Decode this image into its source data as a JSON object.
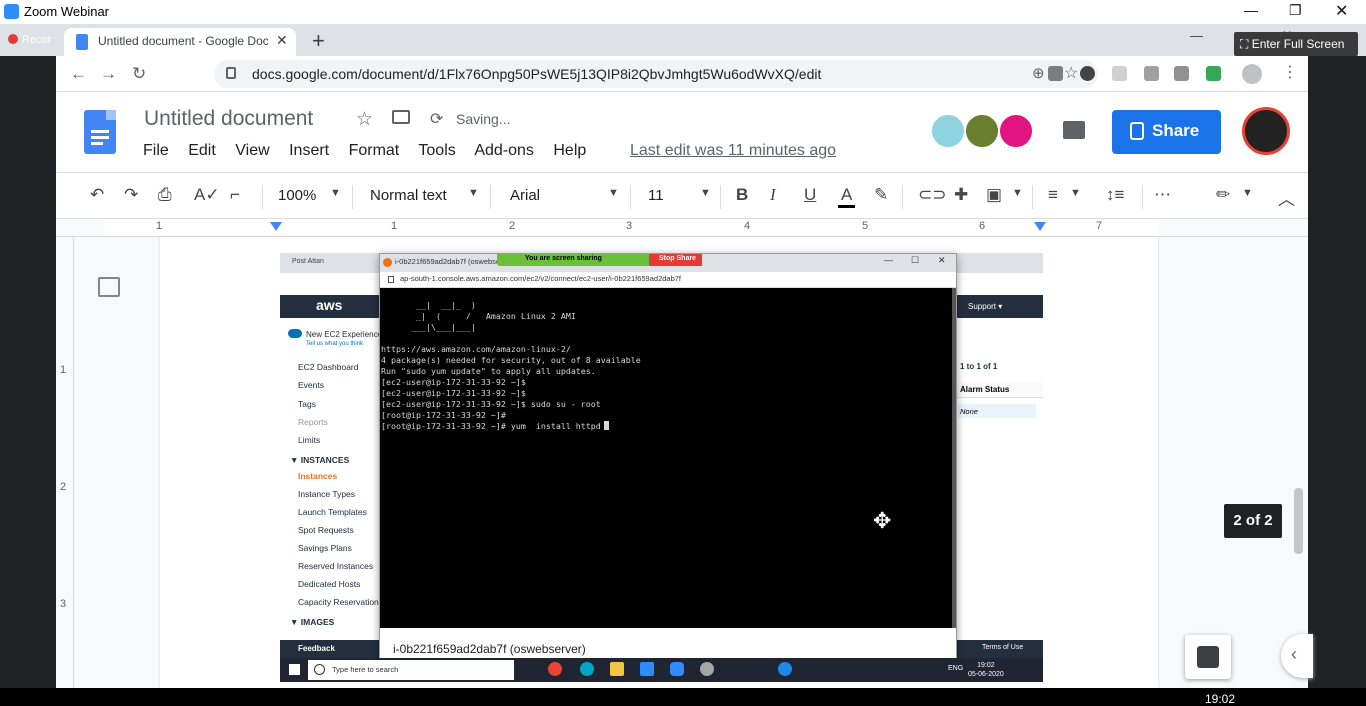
{
  "zoom": {
    "title": "Zoom Webinar",
    "recording": "Recor",
    "fullscreen": "Enter Full Screen"
  },
  "browser": {
    "tab_title": "Untitled document - Google Doc",
    "url": "docs.google.com/document/d/1Flx76Onpg50PsWE5j13QIP8i2QbvJmhgt5Wu6odWvXQ/edit"
  },
  "docs": {
    "title": "Untitled document",
    "saving": "Saving...",
    "menus": [
      "File",
      "Edit",
      "View",
      "Insert",
      "Format",
      "Tools",
      "Add-ons",
      "Help"
    ],
    "last_edit": "Last edit was 11 minutes ago",
    "share": "Share",
    "toolbar": {
      "zoom": "100%",
      "style": "Normal text",
      "font": "Arial",
      "size": "11"
    },
    "ruler_numbers": [
      "1",
      "1",
      "2",
      "3",
      "4",
      "5",
      "6",
      "7"
    ],
    "vruler_numbers": [
      "1",
      "2",
      "3"
    ],
    "page_count": "2 of 2"
  },
  "aws": {
    "inner_tab": "Post Attan",
    "logo": "aws",
    "support": "Support ▾",
    "toggle": "New EC2 Experience",
    "toggle_sub": "Tell us what you think",
    "nav": [
      "EC2 Dashboard",
      "Events",
      "Tags",
      "Reports",
      "Limits"
    ],
    "section_instances": "▼ INSTANCES",
    "instances_items": [
      "Instances",
      "Instance Types",
      "Launch Templates",
      "Spot Requests",
      "Savings Plans",
      "Reserved Instances",
      "Dedicated Hosts",
      "Capacity Reservations"
    ],
    "section_images": "▼ IMAGES",
    "pagination": "1 to 1 of 1",
    "col_alarm": "Alarm Status",
    "alarm_value": "None",
    "feedback": "Feedback",
    "terms": "Terms of Use"
  },
  "popup": {
    "title": "i-0b221f659ad2dab7f (oswebser",
    "sharing": "You are screen sharing",
    "stop": "Stop Share",
    "url": "ap-south-1.console.aws.amazon.com/ec2/v2/connect/ec2-user/i-0b221f659ad2dab7f",
    "status": "i-0b221f659ad2dab7f (oswebserver)"
  },
  "terminal": {
    "lines": [
      "       __|  __|_  )",
      "       _|  (     /   Amazon Linux 2 AMI",
      "      ___|\\___|___|",
      "",
      "https://aws.amazon.com/amazon-linux-2/",
      "4 package(s) needed for security, out of 8 available",
      "Run \"sudo yum update\" to apply all updates.",
      "[ec2-user@ip-172-31-33-92 ~]$",
      "[ec2-user@ip-172-31-33-92 ~]$",
      "[ec2-user@ip-172-31-33-92 ~]$ sudo su - root",
      "[root@ip-172-31-33-92 ~]#",
      "[root@ip-172-31-33-92 ~]# yum  install httpd"
    ]
  },
  "inner_taskbar": {
    "search": "Type here to search",
    "time": "19:02",
    "date": "05-06-2020",
    "lang": "ENG"
  },
  "outer_taskbar": {
    "time": "19:02"
  }
}
